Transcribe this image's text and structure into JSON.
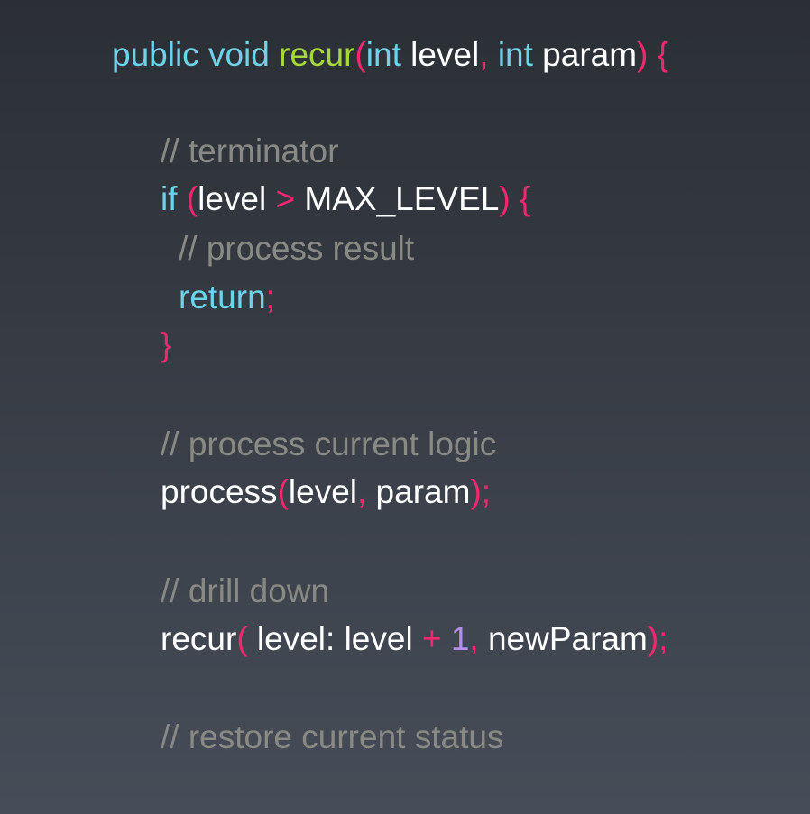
{
  "code": {
    "line1": {
      "t1": "public",
      "t2": " ",
      "t3": "void",
      "t4": " ",
      "t5": "recur",
      "t6": "(",
      "t7": "int",
      "t8": " level",
      "t9": ",",
      "t10": " ",
      "t11": "int",
      "t12": " param",
      "t13": ")",
      "t14": " {"
    },
    "line2": {
      "t1": "// terminator"
    },
    "line3": {
      "t1": "if",
      "t2": " (",
      "t3": "level",
      "t4": " > ",
      "t5": "MAX_LEVEL",
      "t6": ") {"
    },
    "line4": {
      "t1": "// process result"
    },
    "line5": {
      "t1": "return",
      "t2": ";"
    },
    "line6": {
      "t1": "}"
    },
    "line7": {
      "t1": "// process current logic"
    },
    "line8": {
      "t1": "process",
      "t2": "(",
      "t3": "level",
      "t4": ",",
      "t5": " param",
      "t6": ");"
    },
    "line9": {
      "t1": "// drill down"
    },
    "line10": {
      "t1": "recur",
      "t2": "(",
      "t3": " level: level ",
      "t4": "+",
      "t5": " ",
      "t6": "1",
      "t7": ",",
      "t8": " newParam",
      "t9": ");"
    },
    "line11": {
      "t1": "// restore current status"
    }
  },
  "colors": {
    "keyword": "#6fd2e8",
    "function": "#a6d83a",
    "punctuation": "#f2286f",
    "identifier": "#ffffff",
    "comment": "#8a8a84",
    "number": "#b48cf2"
  }
}
